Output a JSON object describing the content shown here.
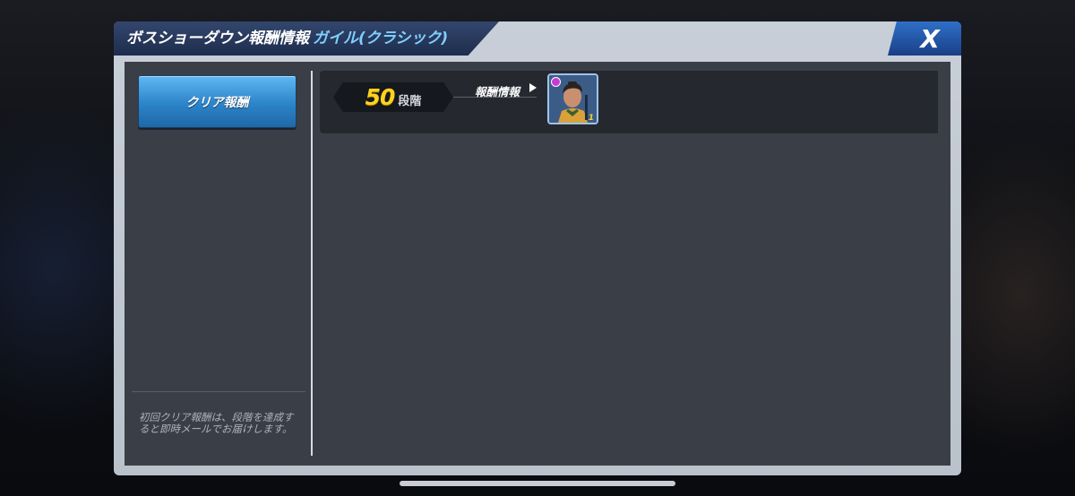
{
  "dialog": {
    "title": "ボスショーダウン報酬情報",
    "subtitle": "ガイル(クラシック)",
    "close_label": "X"
  },
  "sidebar": {
    "tab_label": "クリア報酬",
    "note": "初回クリア報酬は、段階を達成すると即時メールでお届けします。"
  },
  "reward_row": {
    "stage_number": "50",
    "stage_unit": "段階",
    "reward_label": "報酬情報",
    "item_count": "1"
  },
  "colors": {
    "accent_gold": "#ffd21e",
    "tab_blue": "#2c84c9",
    "frame": "#c8cfd8",
    "panel": "#3a3e46",
    "title_sub": "#7fd0ff"
  }
}
